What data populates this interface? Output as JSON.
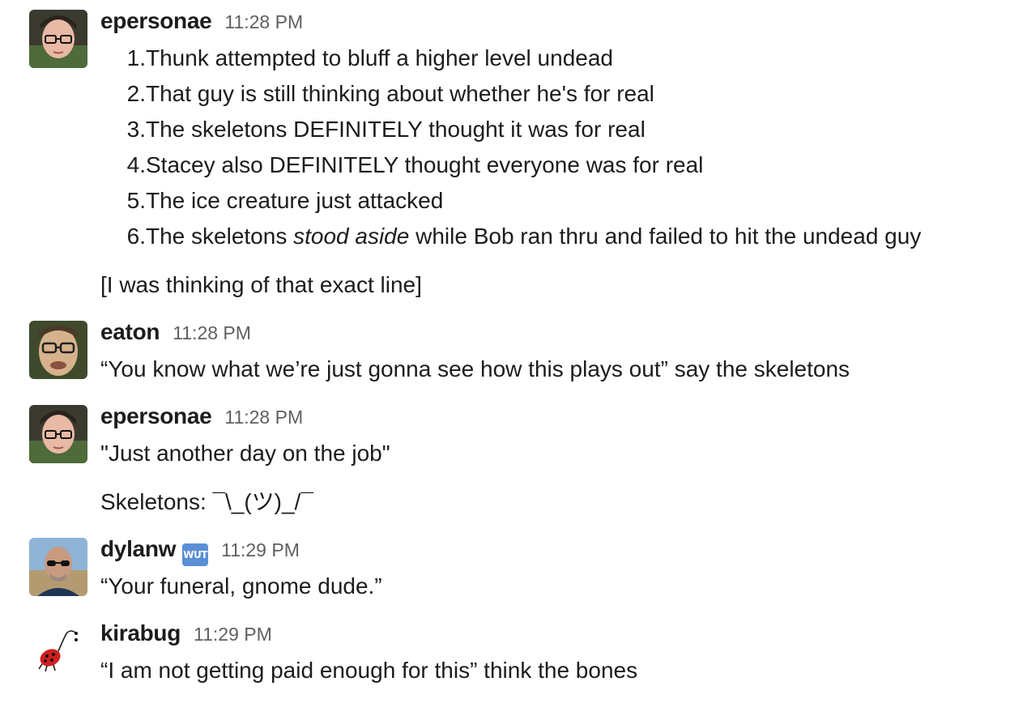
{
  "messages": [
    {
      "user": "epersonae",
      "time": "11:28 PM",
      "avatar": "avatar-epersonae",
      "list": [
        {
          "num": "1.",
          "text": "Thunk attempted to bluff a higher level undead"
        },
        {
          "num": "2.",
          "text": "That guy is still thinking about whether he's for real"
        },
        {
          "num": "3.",
          "text": "The skeletons DEFINITELY thought it was for real"
        },
        {
          "num": "4.",
          "text": "Stacey also DEFINITELY thought everyone was for real"
        },
        {
          "num": "5.",
          "text": "The ice creature just attacked"
        },
        {
          "num": "6.",
          "pre": "The skeletons ",
          "em": "stood aside",
          "post": " while Bob ran thru and failed to hit the undead guy"
        }
      ],
      "followup": "[I was thinking of that exact line]"
    },
    {
      "user": "eaton",
      "time": "11:28 PM",
      "avatar": "avatar-eaton",
      "text": "“You know what we’re just gonna see how this plays out” say the skeletons"
    },
    {
      "user": "epersonae",
      "time": "11:28 PM",
      "avatar": "avatar-epersonae",
      "text": "\"Just another day on the job\"",
      "followup": "Skeletons: ¯\\_(ツ)_/¯"
    },
    {
      "user": "dylanw",
      "badge": "WUT",
      "time": "11:29 PM",
      "avatar": "avatar-dylanw",
      "text": "“Your funeral, gnome dude.”"
    },
    {
      "user": "kirabug",
      "time": "11:29 PM",
      "avatar": "avatar-kirabug",
      "text": "“I am not getting paid enough for this” think the bones"
    }
  ]
}
